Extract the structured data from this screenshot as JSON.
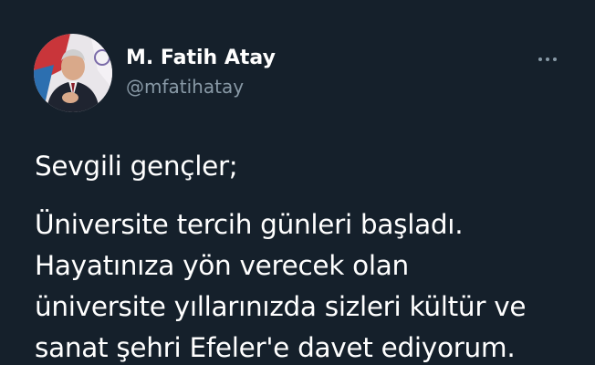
{
  "author": {
    "display_name": "M. Fatih Atay",
    "handle": "@mfatihatay"
  },
  "icons": {
    "more": "more-horizontal-icon"
  },
  "tweet": {
    "greeting": "Sevgili gençler;",
    "lines": [
      "Üniversite tercih günleri başladı.",
      "Hayatınıza yön verecek olan",
      "üniversite yıllarınızda sizleri kültür ve",
      "sanat şehri Efeler'e davet ediyorum."
    ]
  },
  "colors": {
    "background": "#15202b",
    "text": "#ffffff",
    "secondary": "#8899a6"
  }
}
